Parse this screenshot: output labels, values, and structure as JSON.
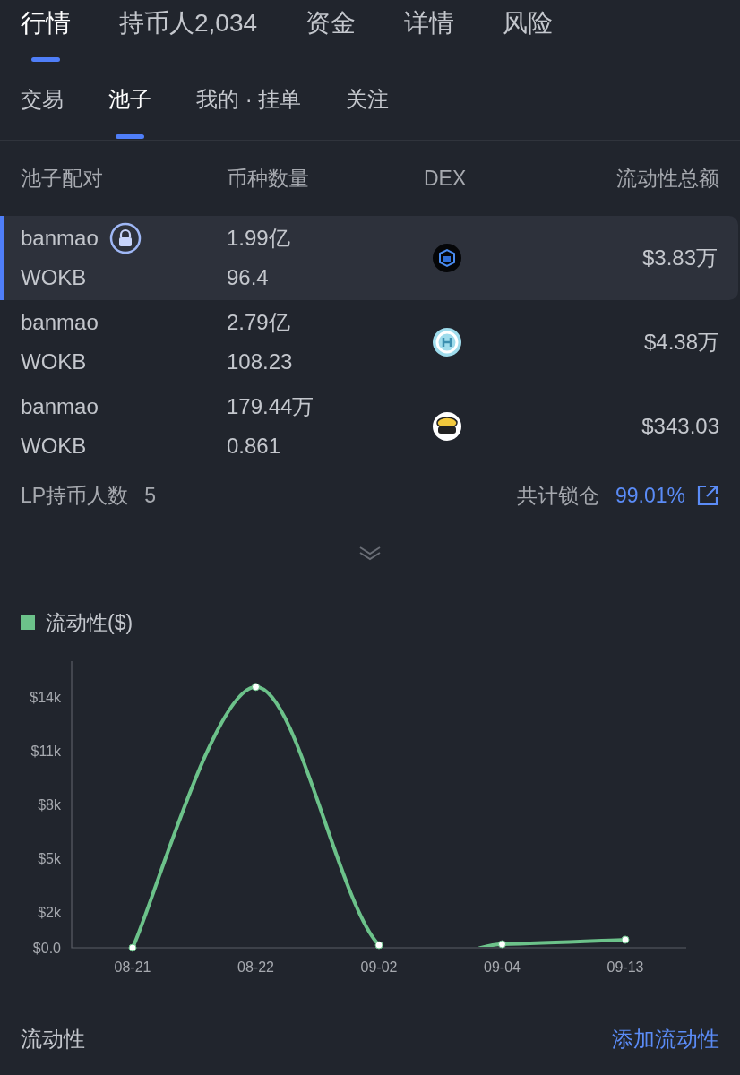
{
  "main_tabs": [
    {
      "label": "行情",
      "selected": true
    },
    {
      "label": "持币人2,034",
      "selected": false
    },
    {
      "label": "资金",
      "selected": false
    },
    {
      "label": "详情",
      "selected": false
    },
    {
      "label": "风险",
      "selected": false
    }
  ],
  "sub_tabs": [
    {
      "label": "交易",
      "selected": false
    },
    {
      "label": "池子",
      "selected": true
    },
    {
      "label": "我的 · 挂单",
      "selected": false
    },
    {
      "label": "关注",
      "selected": false
    }
  ],
  "pool_table": {
    "columns": [
      "池子配对",
      "币种数量",
      "DEX",
      "流动性总额"
    ],
    "rows": [
      {
        "pair": [
          "banmao",
          "WOKB"
        ],
        "locked": true,
        "amounts": [
          "1.99亿",
          "96.4"
        ],
        "dex": {
          "kind": "cube"
        },
        "total": "$3.83万",
        "selected": true
      },
      {
        "pair": [
          "banmao",
          "WOKB"
        ],
        "locked": false,
        "amounts": [
          "2.79亿",
          "108.23"
        ],
        "dex": {
          "kind": "ring"
        },
        "total": "$4.38万",
        "selected": false
      },
      {
        "pair": [
          "banmao",
          "WOKB"
        ],
        "locked": false,
        "amounts": [
          "179.44万",
          "0.861"
        ],
        "dex": {
          "kind": "potato"
        },
        "total": "$343.03",
        "selected": false
      }
    ]
  },
  "lp_holders": {
    "label": "LP持币人数",
    "value": "5"
  },
  "locked_total": {
    "label": "共计锁仓",
    "value": "99.01%"
  },
  "chart": {
    "chart_data": {
      "type": "line",
      "categories": [
        "08-21",
        "08-22",
        "09-02",
        "09-04",
        "09-13"
      ],
      "series": [
        {
          "name": "流动性($)",
          "color": "#6cc28a",
          "marker": "circle",
          "values": [
            0,
            14560,
            150,
            200,
            450
          ]
        }
      ],
      "ylim": [
        0,
        16000
      ],
      "yticks": [
        {
          "value": 0,
          "label": "$0.0"
        },
        {
          "value": 2000,
          "label": "$2k"
        },
        {
          "value": 5000,
          "label": "$5k"
        },
        {
          "value": 8000,
          "label": "$8k"
        },
        {
          "value": 11000,
          "label": "$11k"
        },
        {
          "value": 14000,
          "label": "$14k"
        }
      ]
    }
  },
  "footer": {
    "title": "流动性",
    "action": "添加流动性"
  }
}
